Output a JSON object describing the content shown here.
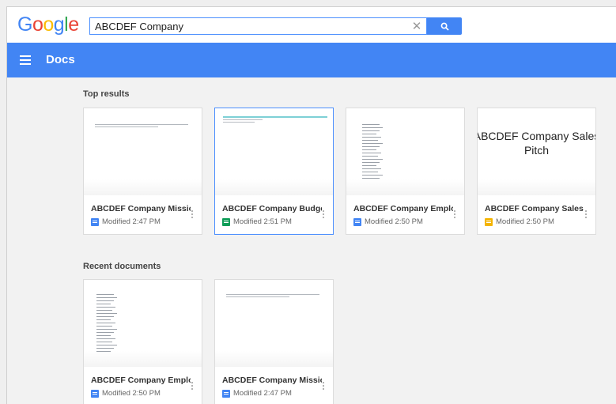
{
  "header": {
    "logo": "Google",
    "logo_colors": [
      "#4285f4",
      "#ea4335",
      "#fbbc05",
      "#4285f4",
      "#34a853",
      "#ea4335"
    ]
  },
  "search": {
    "value": "ABCDEF Company",
    "button_icon": "search-icon",
    "clear_icon": "close-icon"
  },
  "appbar": {
    "title": "Docs",
    "menu_icon": "hamburger-menu-icon",
    "color": "#4285f4"
  },
  "sections": {
    "top": "Top results",
    "recent": "Recent documents"
  },
  "top_results": [
    {
      "title": "ABCDEF Company Missio...",
      "modified": "Modified 2:47 PM",
      "type": "docs"
    },
    {
      "title": "ABCDEF Company Budge...",
      "modified": "Modified 2:51 PM",
      "type": "sheets"
    },
    {
      "title": "ABCDEF Company Emplo...",
      "modified": "Modified 2:50 PM",
      "type": "docs"
    },
    {
      "title": "ABCDEF Company Sales ...",
      "modified": "Modified 2:50 PM",
      "type": "slides",
      "thumb_text": "ABCDEF Company Sales Pitch"
    }
  ],
  "recent_documents": [
    {
      "title": "ABCDEF Company Emplo...",
      "modified": "Modified 2:50 PM",
      "type": "docs"
    },
    {
      "title": "ABCDEF Company Missio...",
      "modified": "Modified 2:47 PM",
      "type": "docs"
    }
  ]
}
